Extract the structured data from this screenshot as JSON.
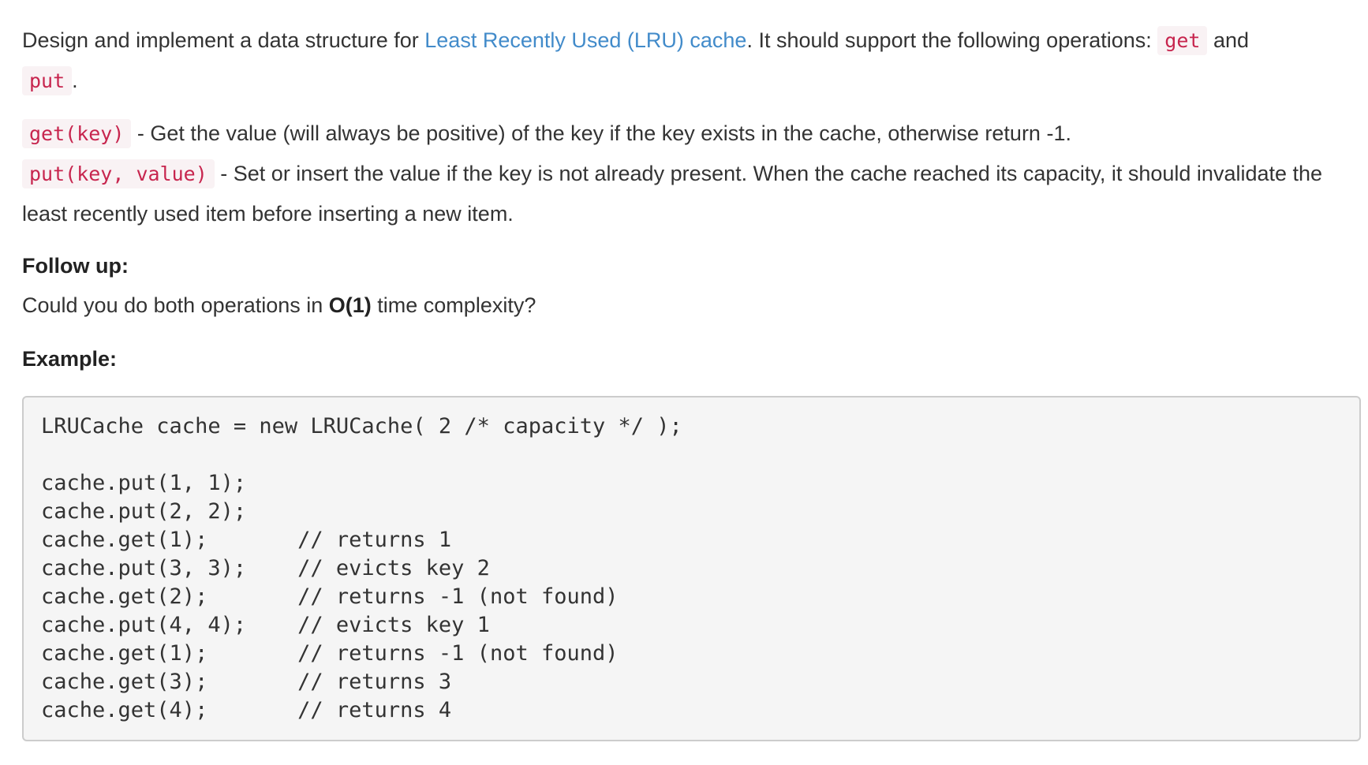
{
  "intro": {
    "text_before_link": "Design and implement a data structure for ",
    "link_text": "Least Recently Used (LRU) cache",
    "text_after_link": ". It should support the following operations: ",
    "op_get": "get",
    "text_and": " and",
    "op_put": "put",
    "text_period": "."
  },
  "get_desc": {
    "code": "get(key)",
    "text": " - Get the value (will always be positive) of the key if the key exists in the cache, otherwise return -1."
  },
  "put_desc": {
    "code": "put(key, value)",
    "text": " - Set or insert the value if the key is not already present. When the cache reached its capacity, it should invalidate the least recently used item before inserting a new item."
  },
  "follow_up": {
    "heading": "Follow up:",
    "text_before": "Could you do both operations in ",
    "bold": "O(1)",
    "text_after": " time complexity?"
  },
  "example": {
    "heading": "Example:",
    "code": "LRUCache cache = new LRUCache( 2 /* capacity */ );\n\ncache.put(1, 1);\ncache.put(2, 2);\ncache.get(1);       // returns 1\ncache.put(3, 3);    // evicts key 2\ncache.get(2);       // returns -1 (not found)\ncache.put(4, 4);    // evicts key 1\ncache.get(1);       // returns -1 (not found)\ncache.get(3);       // returns 3\ncache.get(4);       // returns 4"
  },
  "colors": {
    "link": "#428bca",
    "inline_code_text": "#c7254e",
    "inline_code_bg": "#f9f2f4",
    "code_block_bg": "#f5f5f5"
  }
}
